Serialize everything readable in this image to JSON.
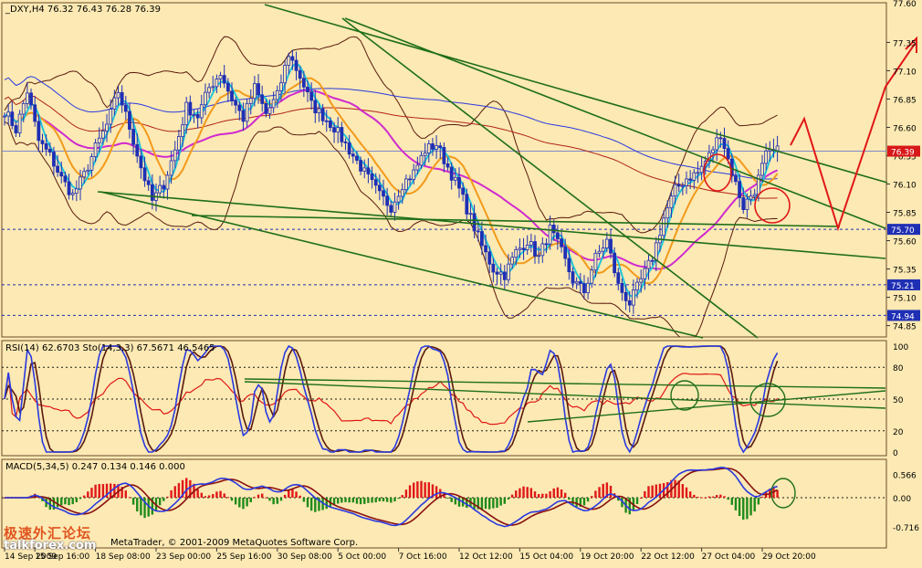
{
  "header": {
    "symbol_line": "_DXY,H4  76.32 76.43 76.28 76.39",
    "rsi_line": "RSI(14) 62.6703  Sto(14,3,3) 67.5671  46.5465",
    "macd_line": "MACD(5,34,5) 0.247 0.134 0.146 0.000",
    "footer_credit": "MetaTrader, © 2001-2009 MetaQuotes Software Corp."
  },
  "watermark": {
    "cn": "极速外汇论坛",
    "site": "talkforex.com"
  },
  "colors": {
    "background": "#fce9b3",
    "candle": "#1f2fb4",
    "cyan": "#22c6d6",
    "orange": "#f29a1b",
    "magenta": "#d02ad0",
    "band": "#5a1a0e",
    "trend": "#1f6e1a",
    "blue_ma": "#2a39e0",
    "red": "#e01818",
    "price_label": "#d81818",
    "grid": "#1f2fb4"
  },
  "chart_data": [
    {
      "type": "candlestick",
      "title": "_DXY,H4",
      "ylim": [
        74.75,
        77.7
      ],
      "price_ticks": [
        "74.85",
        "75.10",
        "75.35",
        "75.60",
        "75.85",
        "76.10",
        "76.35",
        "76.60",
        "76.85",
        "77.10",
        "77.35"
      ],
      "top_label": "77.60",
      "price_labels": [
        {
          "text": "76.39",
          "value": 76.39,
          "color": "#d81818"
        },
        {
          "text": "75.70",
          "value": 75.7,
          "color": "#1f2fb4"
        },
        {
          "text": "75.21",
          "value": 75.21,
          "color": "#1f2fb4"
        },
        {
          "text": "74.94",
          "value": 74.94,
          "color": "#1f2fb4"
        }
      ],
      "time_labels": [
        {
          "text": "14 Sep 2009",
          "i": 0
        },
        {
          "text": "15 Sep 16:00",
          "i": 8
        },
        {
          "text": "18 Sep 08:00",
          "i": 24
        },
        {
          "text": "23 Sep 00:00",
          "i": 40
        },
        {
          "text": "25 Sep 16:00",
          "i": 56
        },
        {
          "text": "30 Sep 08:00",
          "i": 72
        },
        {
          "text": "5 Oct 00:00",
          "i": 88
        },
        {
          "text": "7 Oct 16:00",
          "i": 104
        },
        {
          "text": "12 Oct 12:00",
          "i": 120
        },
        {
          "text": "15 Oct 04:00",
          "i": 136
        },
        {
          "text": "19 Oct 20:00",
          "i": 152
        },
        {
          "text": "22 Oct 12:00",
          "i": 168
        },
        {
          "text": "27 Oct 04:00",
          "i": 184
        },
        {
          "text": "29 Oct 20:00",
          "i": 200
        }
      ],
      "close_anchors": [
        [
          0,
          76.75
        ],
        [
          3,
          76.58
        ],
        [
          6,
          76.92
        ],
        [
          9,
          76.48
        ],
        [
          12,
          76.35
        ],
        [
          15,
          76.15
        ],
        [
          18,
          76.0
        ],
        [
          21,
          76.18
        ],
        [
          24,
          76.42
        ],
        [
          27,
          76.62
        ],
        [
          30,
          76.92
        ],
        [
          33,
          76.6
        ],
        [
          36,
          76.25
        ],
        [
          39,
          75.95
        ],
        [
          42,
          76.1
        ],
        [
          45,
          76.4
        ],
        [
          48,
          76.78
        ],
        [
          51,
          76.7
        ],
        [
          54,
          76.95
        ],
        [
          57,
          77.08
        ],
        [
          60,
          76.85
        ],
        [
          63,
          76.68
        ],
        [
          66,
          76.95
        ],
        [
          69,
          76.72
        ],
        [
          72,
          76.88
        ],
        [
          75,
          77.25
        ],
        [
          78,
          77.05
        ],
        [
          81,
          76.8
        ],
        [
          84,
          76.7
        ],
        [
          87,
          76.6
        ],
        [
          90,
          76.45
        ],
        [
          93,
          76.3
        ],
        [
          96,
          76.15
        ],
        [
          99,
          76.0
        ],
        [
          102,
          75.9
        ],
        [
          105,
          76.1
        ],
        [
          108,
          76.2
        ],
        [
          111,
          76.4
        ],
        [
          114,
          76.45
        ],
        [
          117,
          76.25
        ],
        [
          120,
          76.05
        ],
        [
          123,
          75.8
        ],
        [
          126,
          75.55
        ],
        [
          129,
          75.35
        ],
        [
          132,
          75.3
        ],
        [
          135,
          75.5
        ],
        [
          138,
          75.6
        ],
        [
          141,
          75.45
        ],
        [
          144,
          75.7
        ],
        [
          147,
          75.5
        ],
        [
          150,
          75.25
        ],
        [
          153,
          75.15
        ],
        [
          156,
          75.45
        ],
        [
          159,
          75.6
        ],
        [
          162,
          75.2
        ],
        [
          165,
          75.05
        ],
        [
          168,
          75.25
        ],
        [
          171,
          75.45
        ],
        [
          174,
          75.8
        ],
        [
          177,
          76.05
        ],
        [
          180,
          76.15
        ],
        [
          183,
          76.2
        ],
        [
          186,
          76.35
        ],
        [
          189,
          76.55
        ],
        [
          192,
          76.2
        ],
        [
          195,
          75.9
        ],
        [
          198,
          76.05
        ],
        [
          201,
          76.35
        ],
        [
          204,
          76.39
        ]
      ]
    },
    {
      "type": "line",
      "title": "RSI(14) / Sto(14,3,3)",
      "ylim": [
        0,
        100
      ],
      "ticks": [
        "100",
        "80",
        "50",
        "20",
        "0"
      ],
      "series": [
        {
          "name": "RSI(14)",
          "value": 62.6703,
          "color": "#e01818"
        },
        {
          "name": "Sto(14,3,3) %K",
          "value": 67.5671,
          "color": "#2a39e0"
        },
        {
          "name": "Sto(14,3,3) %D",
          "value": 46.5465,
          "color": "#5a1a0e"
        }
      ]
    },
    {
      "type": "bar",
      "title": "MACD(5,34,5)",
      "ylim": [
        -0.716,
        0.566
      ],
      "ticks": [
        "0.566",
        "0.00",
        "-0.716"
      ],
      "values": {
        "macd": 0.247,
        "signal": 0.134,
        "osma": 0.146
      }
    }
  ]
}
